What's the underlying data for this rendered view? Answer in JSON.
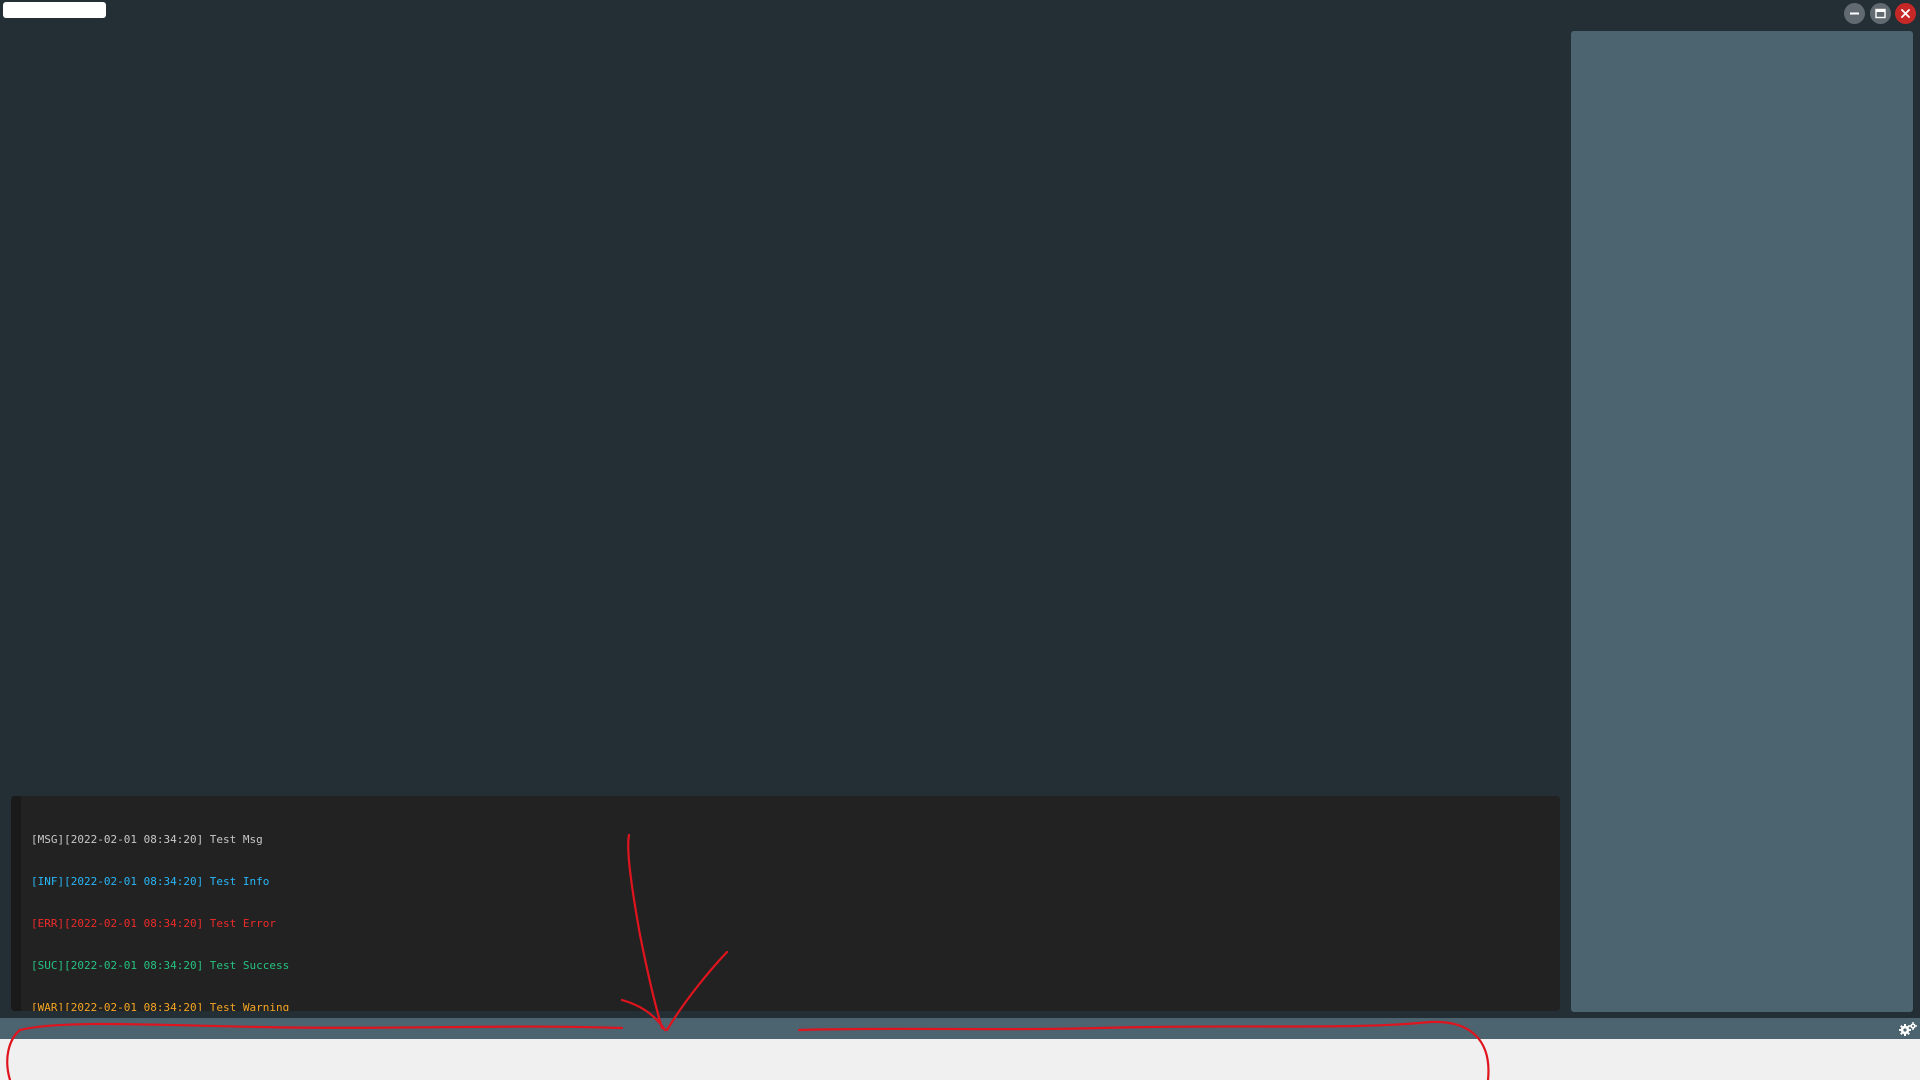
{
  "window": {
    "controls": [
      "minimize",
      "maximize",
      "close"
    ],
    "colors": {
      "background": "#242e35",
      "panel": "#4b6470",
      "close_button": "#c62828"
    }
  },
  "console": {
    "lines": [
      {
        "level": "MSG",
        "text": "[MSG][2022-02-01 08:34:20] Test Msg",
        "color": "#c8c8c8"
      },
      {
        "level": "INF",
        "text": "[INF][2022-02-01 08:34:20] Test Info",
        "color": "#29b6f6"
      },
      {
        "level": "ERR",
        "text": "[ERR][2022-02-01 08:34:20] Test Error",
        "color": "#ef2a2a"
      },
      {
        "level": "SUC",
        "text": "[SUC][2022-02-01 08:34:20] Test Success",
        "color": "#26c281"
      },
      {
        "level": "WAR",
        "text": "[WAR][2022-02-01 08:34:20] Test Warning",
        "color": "#f5a623"
      }
    ],
    "prompt": "$",
    "prompt_color": "#c8c8c8"
  },
  "status_bar": {
    "settings_icon": "gears-icon"
  },
  "annotation": {
    "color": "#e0141e"
  }
}
